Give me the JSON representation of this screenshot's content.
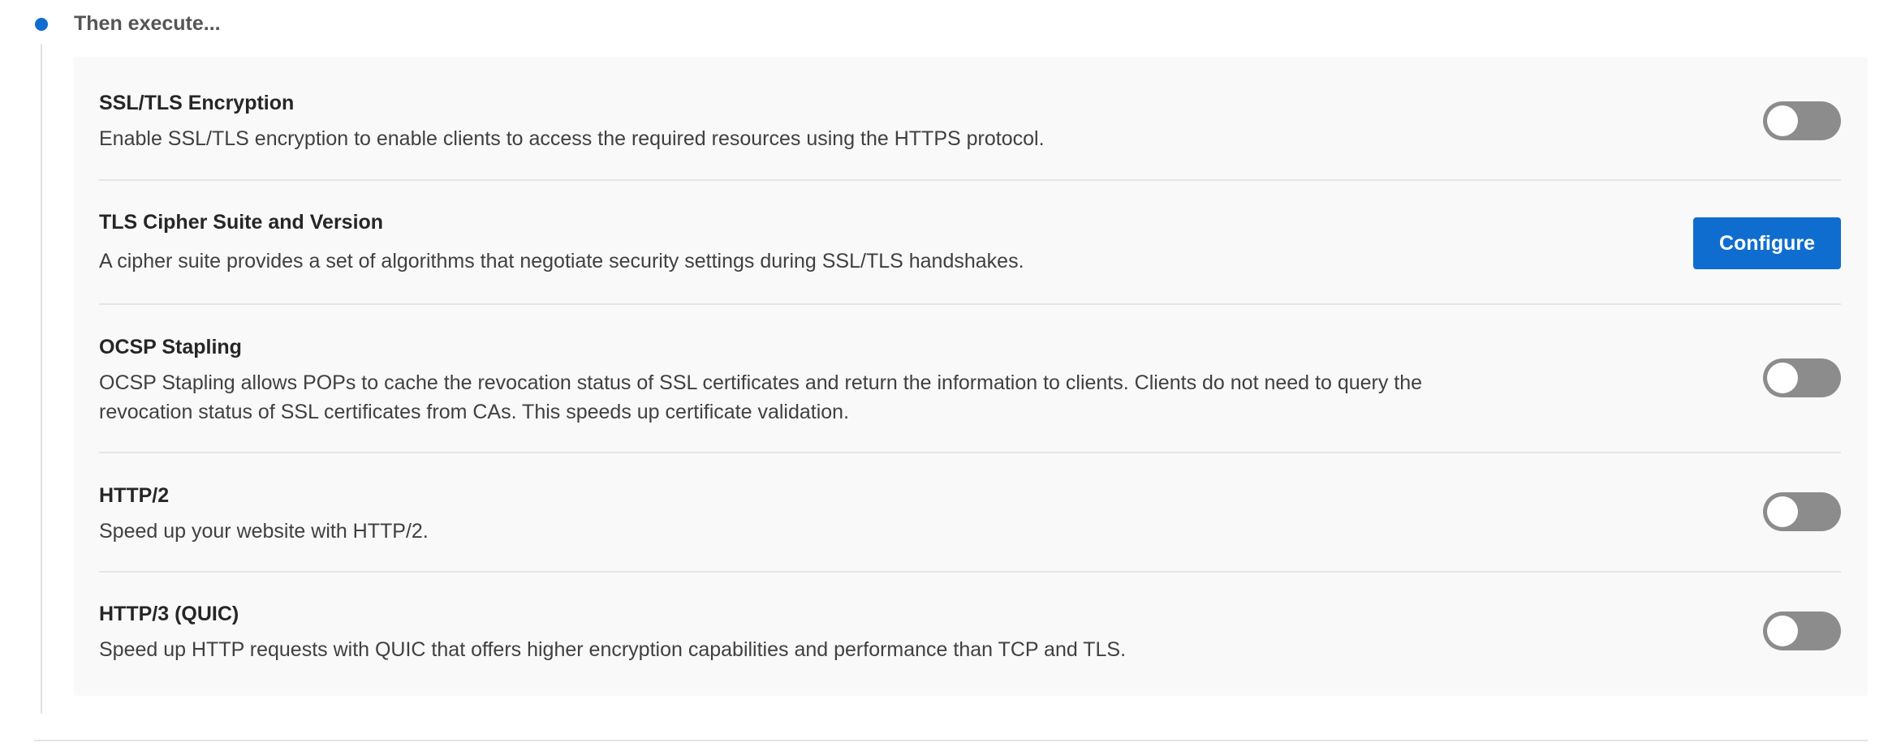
{
  "step": {
    "title": "Then execute..."
  },
  "settings": [
    {
      "title": "SSL/TLS Encryption",
      "description": "Enable SSL/TLS encryption to enable clients to access the required resources using the HTTPS protocol.",
      "control": "toggle",
      "enabled": false
    },
    {
      "title": "TLS Cipher Suite and Version",
      "description": "A cipher suite provides a set of algorithms that negotiate security settings during SSL/TLS handshakes.",
      "control": "button",
      "button_label": "Configure"
    },
    {
      "title": "OCSP Stapling",
      "description_lines": [
        "OCSP Stapling allows POPs to cache the revocation status of SSL certificates and return the information to clients. Clients do not need to query the",
        "revocation status of SSL certificates from CAs. This speeds up certificate validation."
      ],
      "control": "toggle",
      "enabled": false
    },
    {
      "title": "HTTP/2",
      "description": "Speed up your website with HTTP/2.",
      "control": "toggle",
      "enabled": false
    },
    {
      "title": "HTTP/3 (QUIC)",
      "description": "Speed up HTTP requests with QUIC that offers higher encryption capabilities and performance than TCP and TLS.",
      "control": "toggle",
      "enabled": false
    }
  ],
  "colors": {
    "accent": "#0f6dcf",
    "toggle_off": "#8c8c8c",
    "panel_bg": "#f9f9f9"
  }
}
